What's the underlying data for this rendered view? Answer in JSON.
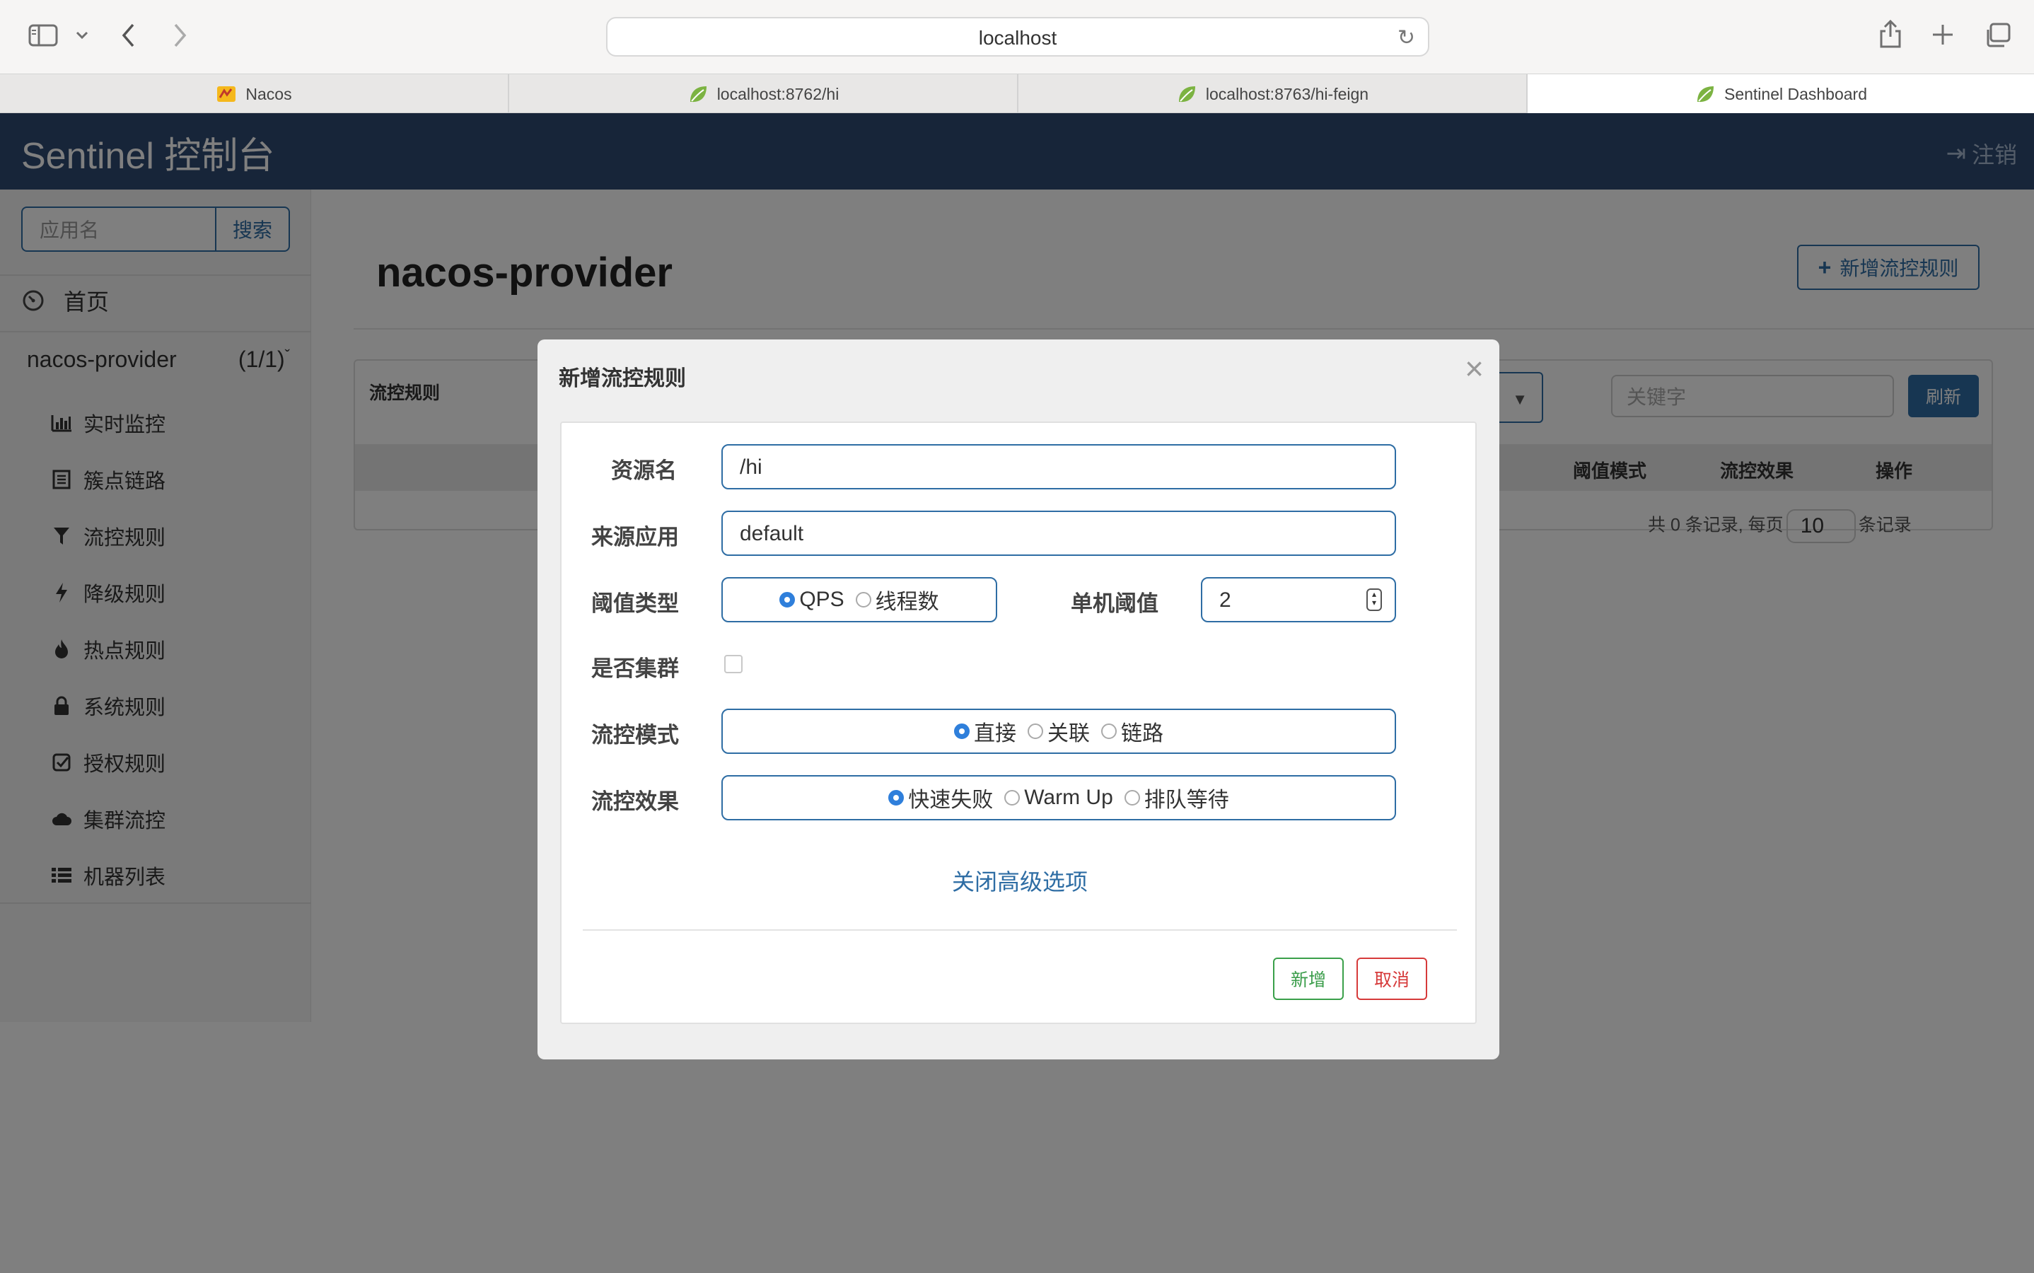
{
  "browser": {
    "url": "localhost",
    "tabs": [
      {
        "label": "Nacos"
      },
      {
        "label": "localhost:8762/hi"
      },
      {
        "label": "localhost:8763/hi-feign"
      },
      {
        "label": "Sentinel Dashboard"
      }
    ]
  },
  "header": {
    "brand": "Sentinel 控制台",
    "logout_label": "注销"
  },
  "sidebar": {
    "search_placeholder": "应用名",
    "search_button": "搜索",
    "home_label": "首页",
    "app_name": "nacos-provider",
    "app_count": "(1/1)",
    "items": [
      {
        "label": "实时监控",
        "icon": "bar-chart-icon"
      },
      {
        "label": "簇点链路",
        "icon": "list-icon"
      },
      {
        "label": "流控规则",
        "icon": "filter-icon"
      },
      {
        "label": "降级规则",
        "icon": "bolt-icon"
      },
      {
        "label": "热点规则",
        "icon": "fire-icon"
      },
      {
        "label": "系统规则",
        "icon": "lock-icon"
      },
      {
        "label": "授权规则",
        "icon": "check-square-icon"
      },
      {
        "label": "集群流控",
        "icon": "cloud-icon"
      },
      {
        "label": "机器列表",
        "icon": "th-list-icon"
      }
    ]
  },
  "main": {
    "title": "nacos-provider",
    "add_button": "新增流控规则",
    "panel": {
      "title": "流控规则",
      "keyword_placeholder": "关键字",
      "refresh_button": "刷新",
      "columns": {
        "threshold_mode": "阈值模式",
        "effect": "流控效果",
        "ops": "操作"
      },
      "pager_prefix": "共 0 条记录, 每页",
      "page_size": "10",
      "pager_suffix": "条记录"
    }
  },
  "modal": {
    "title": "新增流控规则",
    "resource_label": "资源名",
    "resource_value": "/hi",
    "origin_label": "来源应用",
    "origin_value": "default",
    "threshold_type_label": "阈值类型",
    "threshold_type_options": [
      "QPS",
      "线程数"
    ],
    "threshold_type_selected": "QPS",
    "threshold_label": "单机阈值",
    "threshold_value": "2",
    "cluster_label": "是否集群",
    "cluster_checked": false,
    "mode_label": "流控模式",
    "mode_options": [
      "直接",
      "关联",
      "链路"
    ],
    "mode_selected": "直接",
    "effect_label": "流控效果",
    "effect_options": [
      "快速失败",
      "Warm Up",
      "排队等待"
    ],
    "effect_selected": "快速失败",
    "advanced_link": "关闭高级选项",
    "confirm_button": "新增",
    "cancel_button": "取消"
  }
}
